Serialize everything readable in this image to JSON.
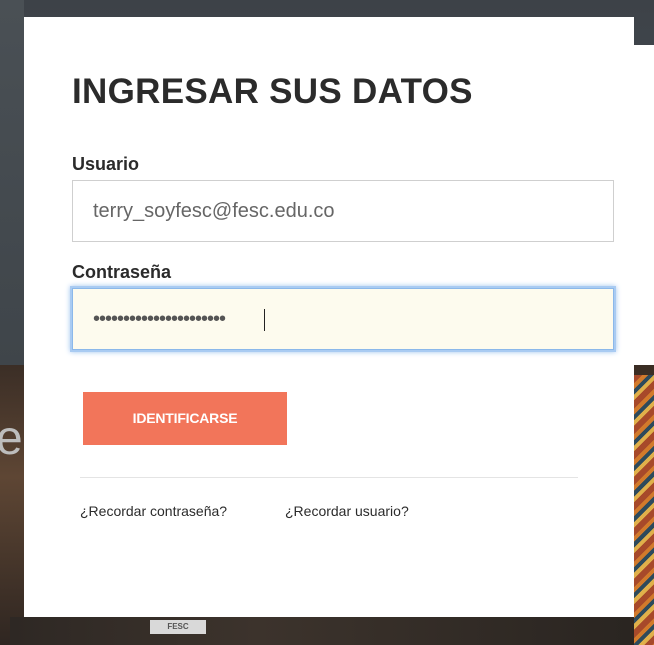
{
  "modal": {
    "title": "INGRESAR SUS DATOS",
    "username": {
      "label": "Usuario",
      "value": "terry_soyfesc@fesc.edu.co"
    },
    "password": {
      "label": "Contraseña",
      "value": "••••••••••••••••••••••"
    },
    "submit_label": "IDENTIFICARSE",
    "links": {
      "forgot_password": "¿Recordar contraseña?",
      "forgot_username": "¿Recordar usuario?"
    }
  },
  "background": {
    "partial_letter": "e",
    "sign_text": "FESC"
  },
  "colors": {
    "accent": "#f2755a",
    "focus_border": "#8bb8ea",
    "autofill_background": "#fdfbee",
    "title_text": "#2b2b2b"
  }
}
